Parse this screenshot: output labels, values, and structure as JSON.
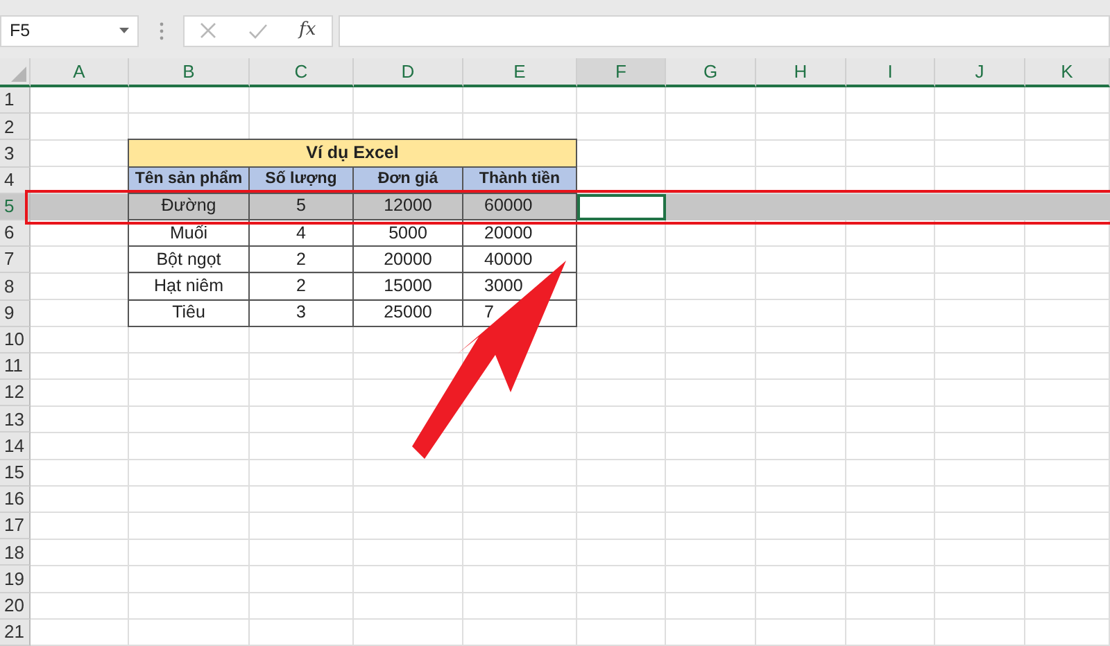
{
  "name_box": {
    "value": "F5"
  },
  "formula_bar": {
    "function_label": "fx"
  },
  "columns": [
    {
      "label": "A",
      "active": false
    },
    {
      "label": "B",
      "active": false
    },
    {
      "label": "C",
      "active": false
    },
    {
      "label": "D",
      "active": false
    },
    {
      "label": "E",
      "active": false
    },
    {
      "label": "F",
      "active": true
    },
    {
      "label": "G",
      "active": false
    },
    {
      "label": "H",
      "active": false
    },
    {
      "label": "I",
      "active": false
    },
    {
      "label": "J",
      "active": false
    },
    {
      "label": "K",
      "active": false
    }
  ],
  "rows": [
    {
      "number": "1",
      "selected": false
    },
    {
      "number": "2",
      "selected": false
    },
    {
      "number": "3",
      "selected": false
    },
    {
      "number": "4",
      "selected": false
    },
    {
      "number": "5",
      "selected": true
    },
    {
      "number": "6",
      "selected": false
    },
    {
      "number": "7",
      "selected": false
    },
    {
      "number": "8",
      "selected": false
    },
    {
      "number": "9",
      "selected": false
    },
    {
      "number": "10",
      "selected": false
    },
    {
      "number": "11",
      "selected": false
    },
    {
      "number": "12",
      "selected": false
    },
    {
      "number": "13",
      "selected": false
    },
    {
      "number": "14",
      "selected": false
    },
    {
      "number": "15",
      "selected": false
    },
    {
      "number": "16",
      "selected": false
    },
    {
      "number": "17",
      "selected": false
    },
    {
      "number": "18",
      "selected": false
    },
    {
      "number": "19",
      "selected": false
    },
    {
      "number": "20",
      "selected": false
    },
    {
      "number": "21",
      "selected": false
    }
  ],
  "table": {
    "title": "Ví dụ Excel",
    "headers": [
      "Tên sản phẩm",
      "Số lượng",
      "Đơn giá",
      "Thành tiền"
    ],
    "rows": [
      {
        "cells": [
          "Đường",
          "5",
          "12000",
          "60000"
        ]
      },
      {
        "cells": [
          "Muối",
          "4",
          "5000",
          "20000"
        ]
      },
      {
        "cells": [
          "Bột ngọt",
          "2",
          "20000",
          "40000"
        ]
      },
      {
        "cells": [
          "Hạt niêm",
          "2",
          "15000",
          "3000"
        ]
      },
      {
        "cells": [
          "Tiêu",
          "3",
          "25000",
          "7"
        ]
      }
    ]
  }
}
